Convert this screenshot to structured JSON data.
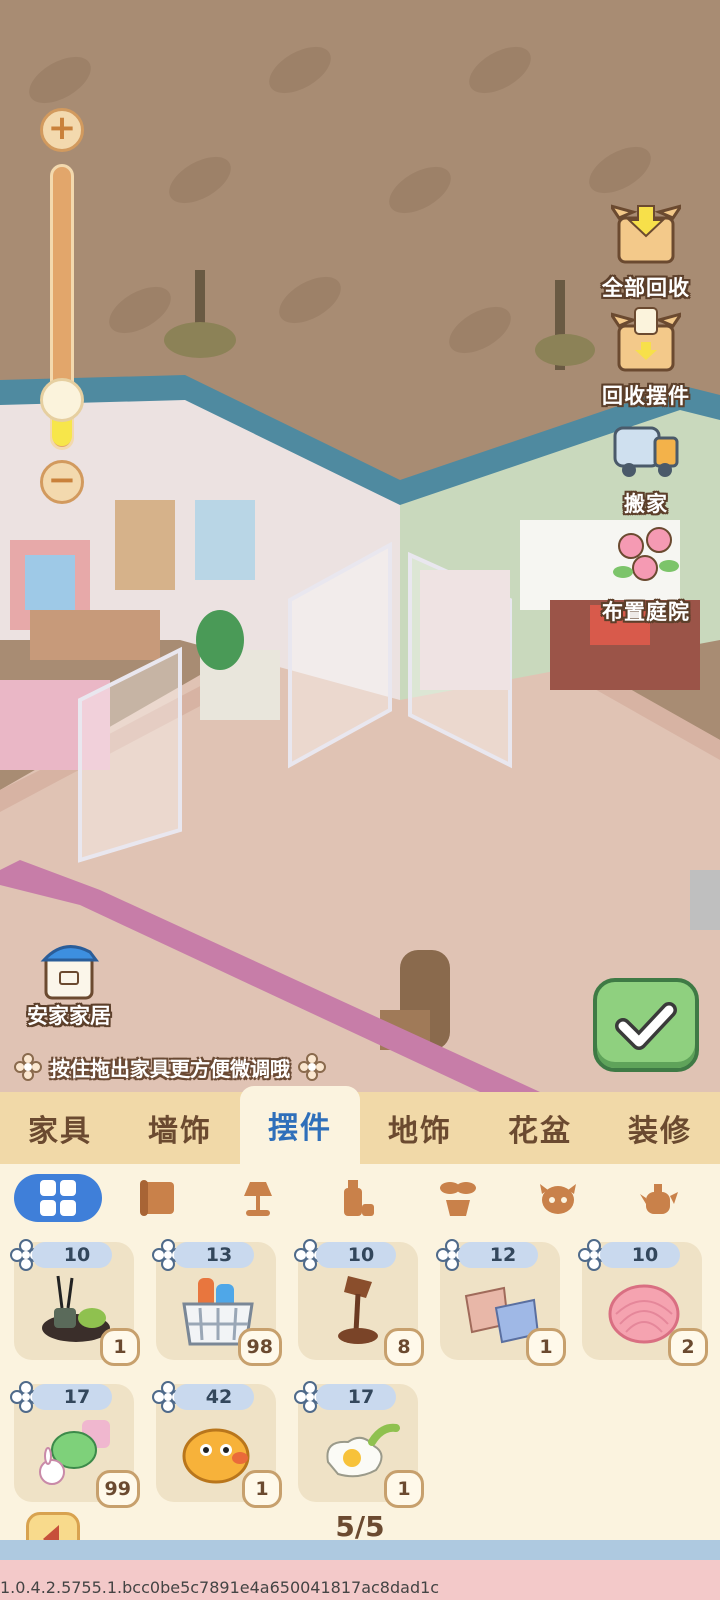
{
  "zoom": {
    "in_icon": "+",
    "out_icon": "−",
    "level": 0.22
  },
  "side_actions": [
    {
      "label": "全部回收",
      "icon": "box-recycle-all-icon"
    },
    {
      "label": "回收摆件",
      "icon": "box-recycle-decor-icon"
    },
    {
      "label": "搬家",
      "icon": "moving-truck-icon"
    },
    {
      "label": "布置庭院",
      "icon": "garden-flower-icon"
    }
  ],
  "home": {
    "label": "安家家居"
  },
  "hint": {
    "text": "按住拖出家具更方便微调哦"
  },
  "tabs": [
    {
      "label": "家具",
      "active": false
    },
    {
      "label": "墙饰",
      "active": false
    },
    {
      "label": "摆件",
      "active": true
    },
    {
      "label": "地饰",
      "active": false
    },
    {
      "label": "花盆",
      "active": false
    },
    {
      "label": "装修",
      "active": false
    }
  ],
  "subcategories": [
    "grid-all-icon",
    "scroll-icon",
    "lamp-icon",
    "bottle-icon",
    "plant-icon",
    "cow-icon",
    "teapot-icon"
  ],
  "items": [
    {
      "cost": "10",
      "qty": "1",
      "icon": "incense-diffuser-icon"
    },
    {
      "cost": "13",
      "qty": "98",
      "icon": "cleaning-basket-icon"
    },
    {
      "cost": "10",
      "qty": "8",
      "icon": "desk-lamp-icon"
    },
    {
      "cost": "12",
      "qty": "1",
      "icon": "pillows-icon"
    },
    {
      "cost": "10",
      "qty": "2",
      "icon": "pink-shell-icon"
    },
    {
      "cost": "17",
      "qty": "99",
      "icon": "plush-toys-icon"
    },
    {
      "cost": "42",
      "qty": "1",
      "icon": "yellow-bird-icon"
    },
    {
      "cost": "17",
      "qty": "1",
      "icon": "fried-egg-icon"
    }
  ],
  "pagination": {
    "text": "5/5"
  },
  "version": "1.0.4.2.5755.1.bcc0be5c7891e4a650041817ac8dad1c"
}
